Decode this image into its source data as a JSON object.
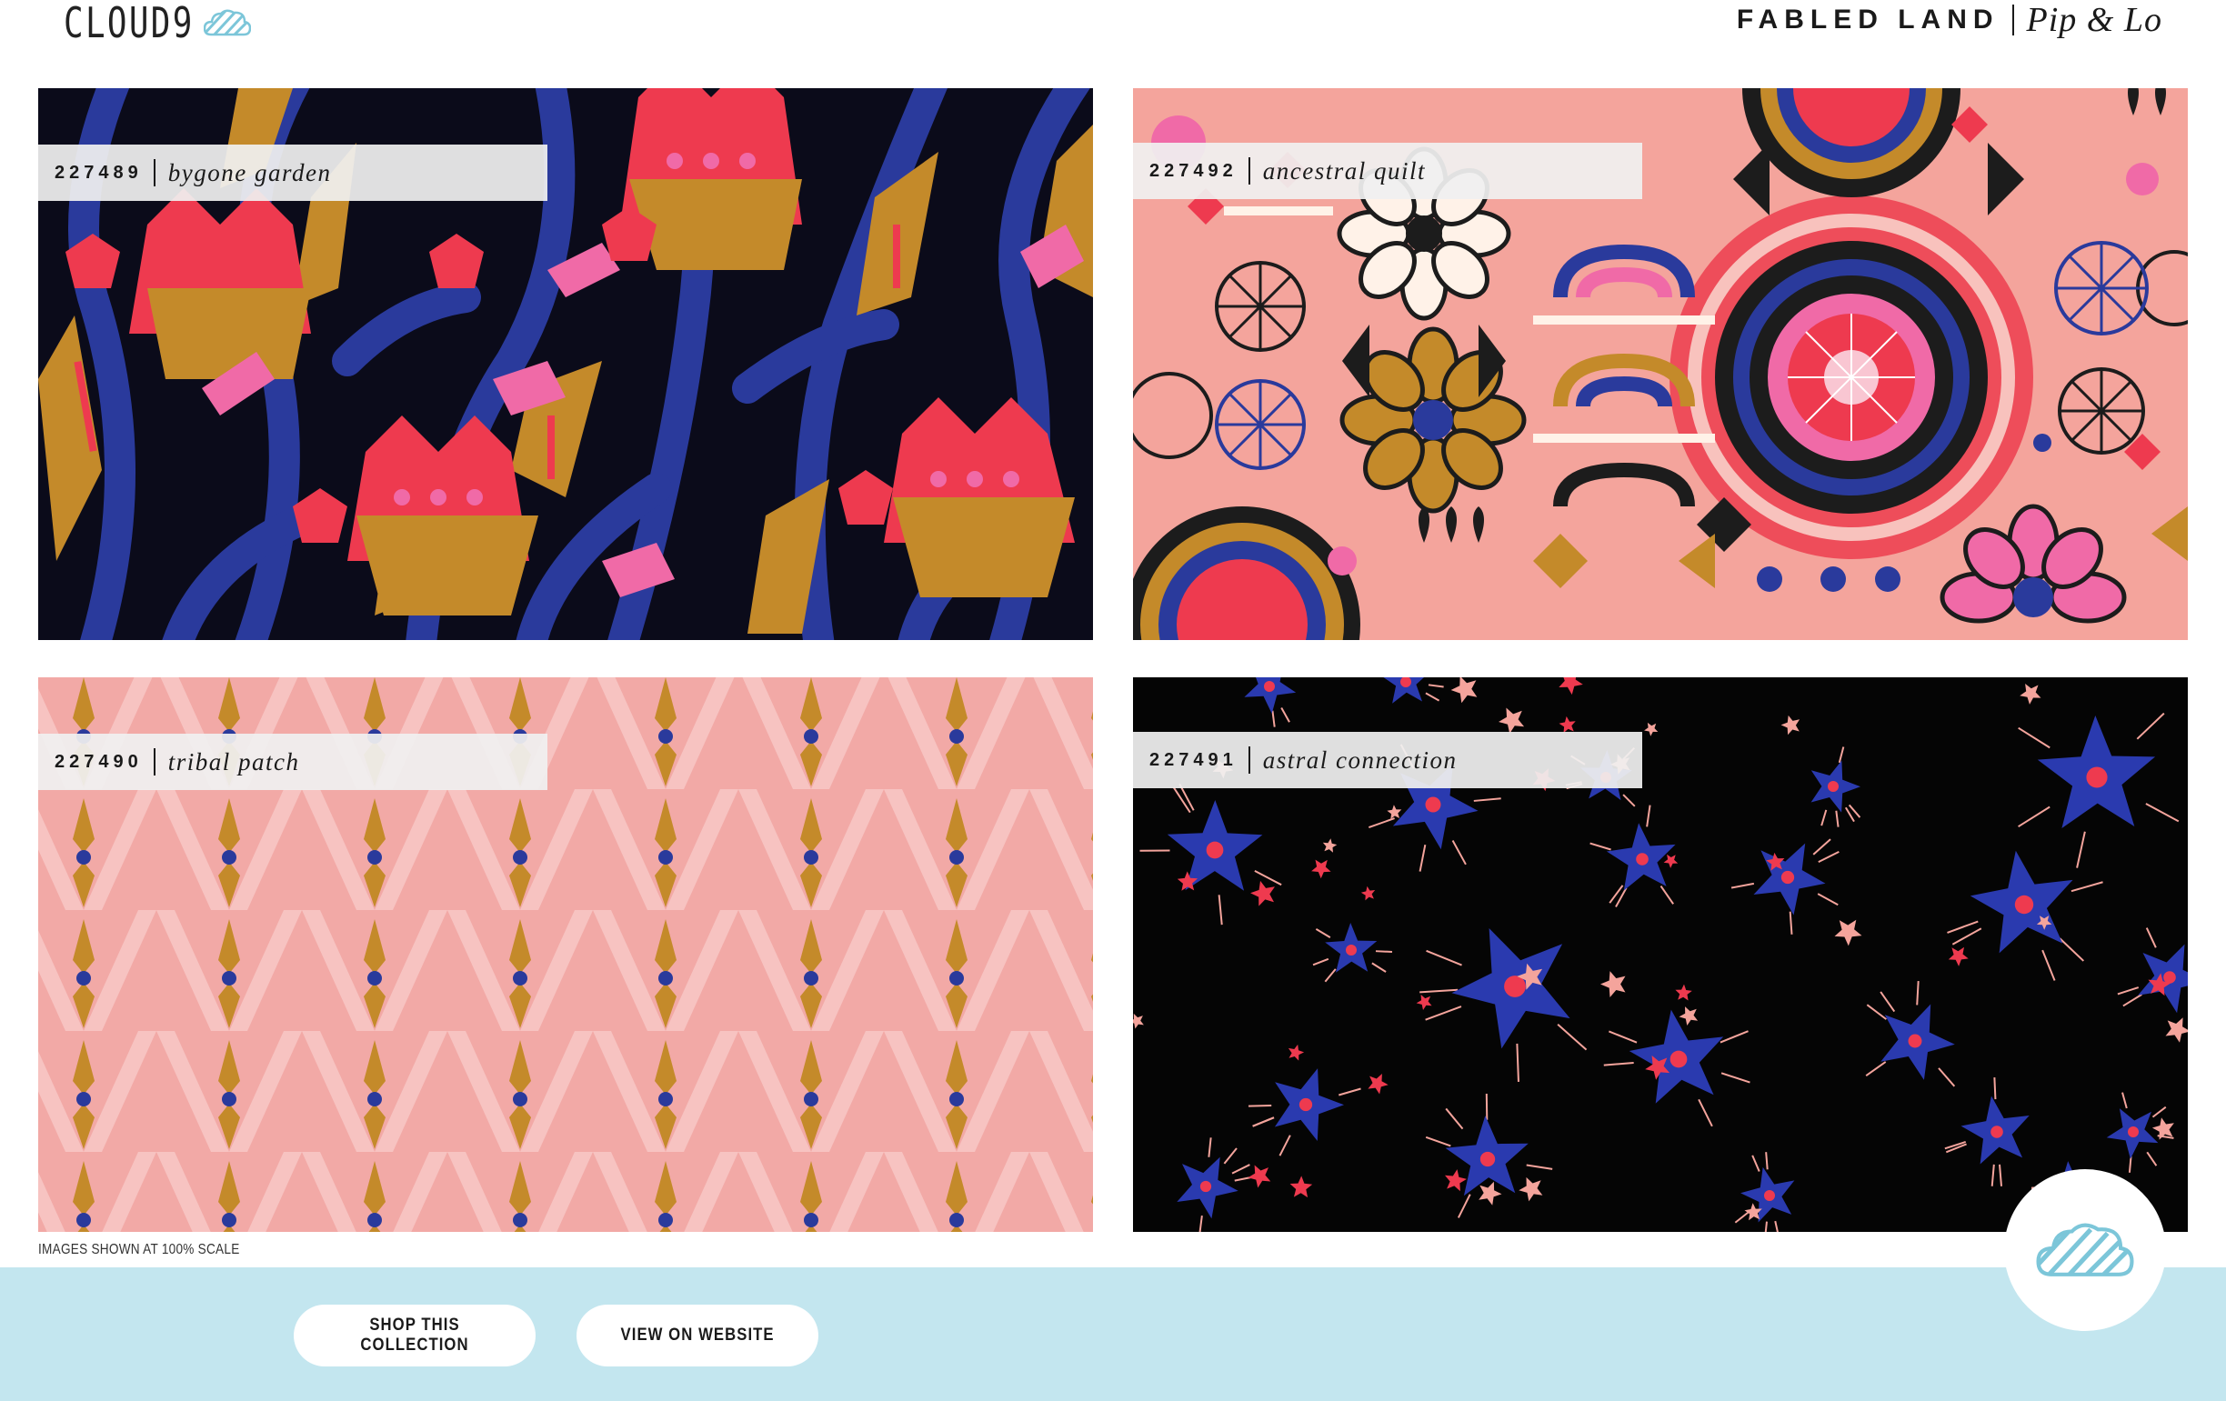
{
  "header": {
    "brand": "CLOUD9",
    "brand_icon": "cloud-icon",
    "collection_name": "FABLED LAND",
    "designer": "Pip & Lo"
  },
  "tiles": [
    {
      "sku": "227489",
      "name": "bygone garden"
    },
    {
      "sku": "227492",
      "name": "ancestral quilt"
    },
    {
      "sku": "227490",
      "name": "tribal patch"
    },
    {
      "sku": "227491",
      "name": "astral connection"
    }
  ],
  "scale_note": "IMAGES SHOWN AT 100% SCALE",
  "footer": {
    "shop_button": "SHOP THIS COLLECTION",
    "view_button": "VIEW ON WEBSITE",
    "badge_icon": "cloud-icon"
  },
  "colors": {
    "footer_bg": "#c3e6ef",
    "cloud_accent": "#7cc6d9",
    "navy": "#2a3a9c",
    "red": "#ee3a4f",
    "mustard": "#c48a2a",
    "pink": "#f4a49c"
  }
}
